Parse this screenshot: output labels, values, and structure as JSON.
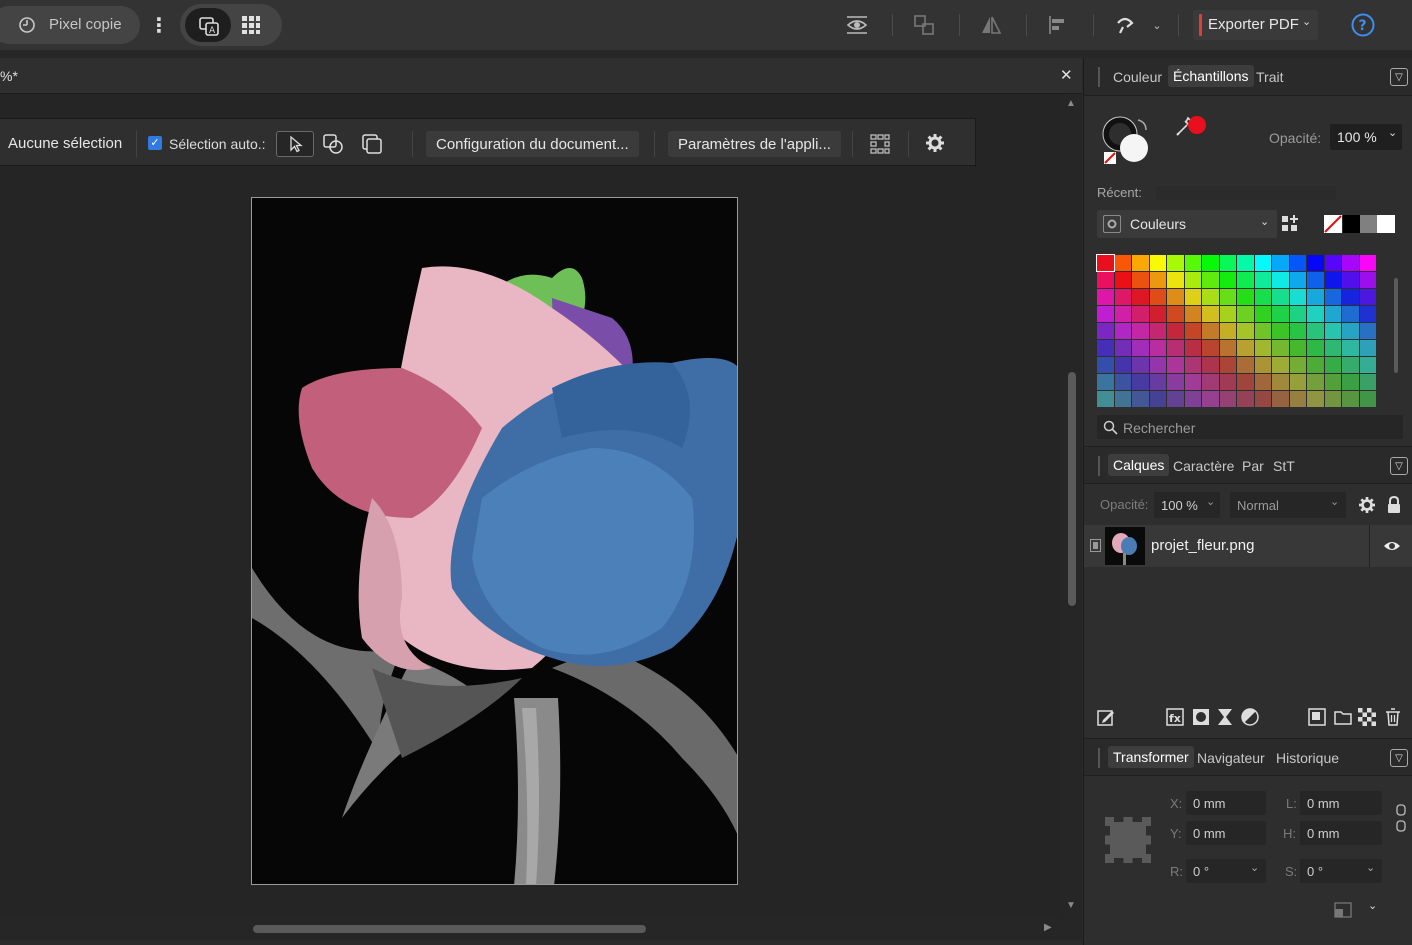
{
  "topbar": {
    "persona_label": "Pixel copie",
    "export_label": "Exporter PDF",
    "help_icon": "question-icon"
  },
  "document": {
    "tab_title": "%*",
    "close_glyph": "✕"
  },
  "context_toolbar": {
    "selection_label": "Aucune sélection",
    "auto_select_label": "Sélection auto.:",
    "auto_select_checked": true,
    "doc_setup_label": "Configuration du document...",
    "app_settings_label": "Paramètres de l'appli..."
  },
  "color_panel": {
    "tabs": [
      "Couleur",
      "Échantillons",
      "Trait"
    ],
    "active_tab": "Échantillons",
    "opacity_label": "Opacité:",
    "opacity_value": "100 %",
    "recent_label": "Récent:",
    "palette_name": "Couleurs",
    "search_placeholder": "Rechercher",
    "accent_swatch": "#e8101c"
  },
  "layers_panel": {
    "tabs": [
      "Calques",
      "Caractère",
      "Par",
      "StT"
    ],
    "active_tab": "Calques",
    "opacity_label": "Opacité:",
    "opacity_value": "100 %",
    "blend_mode": "Normal",
    "layers": [
      {
        "name": "projet_fleur.png",
        "visible": true
      }
    ]
  },
  "transform_panel": {
    "tabs": [
      "Transformer",
      "Navigateur",
      "Historique"
    ],
    "active_tab": "Transformer",
    "x_label": "X:",
    "x_value": "0 mm",
    "y_label": "Y:",
    "y_value": "0 mm",
    "w_label": "L:",
    "w_value": "0 mm",
    "h_label": "H:",
    "h_value": "0 mm",
    "r_label": "R:",
    "r_value": "0 °",
    "s_label": "S:",
    "s_value": "0 °"
  }
}
